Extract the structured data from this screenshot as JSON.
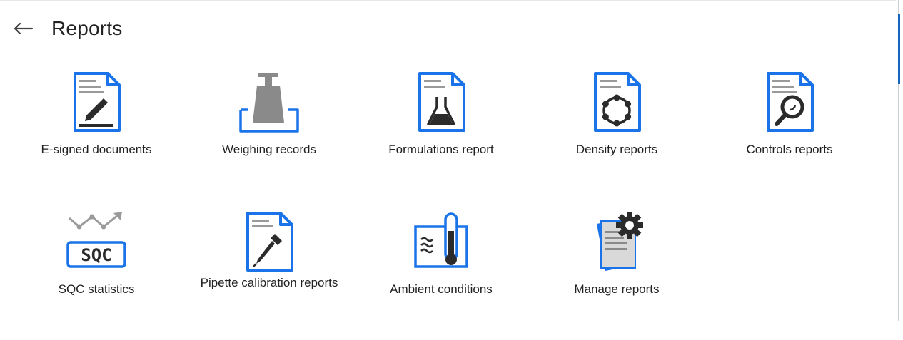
{
  "header": {
    "title": "Reports",
    "back_icon": "arrow-left-icon"
  },
  "tiles": [
    {
      "label": "E-signed documents",
      "icon": "document-pen-icon"
    },
    {
      "label": "Weighing records",
      "icon": "weight-scale-icon"
    },
    {
      "label": "Formulations report",
      "icon": "document-flask-icon"
    },
    {
      "label": "Density reports",
      "icon": "document-ring-icon"
    },
    {
      "label": "Controls reports",
      "icon": "document-magnifier-icon"
    },
    {
      "label": "SQC statistics",
      "icon": "sqc-chart-icon"
    },
    {
      "label": "Pipette calibration reports",
      "icon": "document-pipette-icon"
    },
    {
      "label": "Ambient conditions",
      "icon": "thermometer-icon"
    },
    {
      "label": "Manage reports",
      "icon": "documents-gear-icon"
    }
  ],
  "colors": {
    "accent": "#1a73e8",
    "icon_gray": "#8a8a8a",
    "icon_dark": "#2b2b2b"
  }
}
